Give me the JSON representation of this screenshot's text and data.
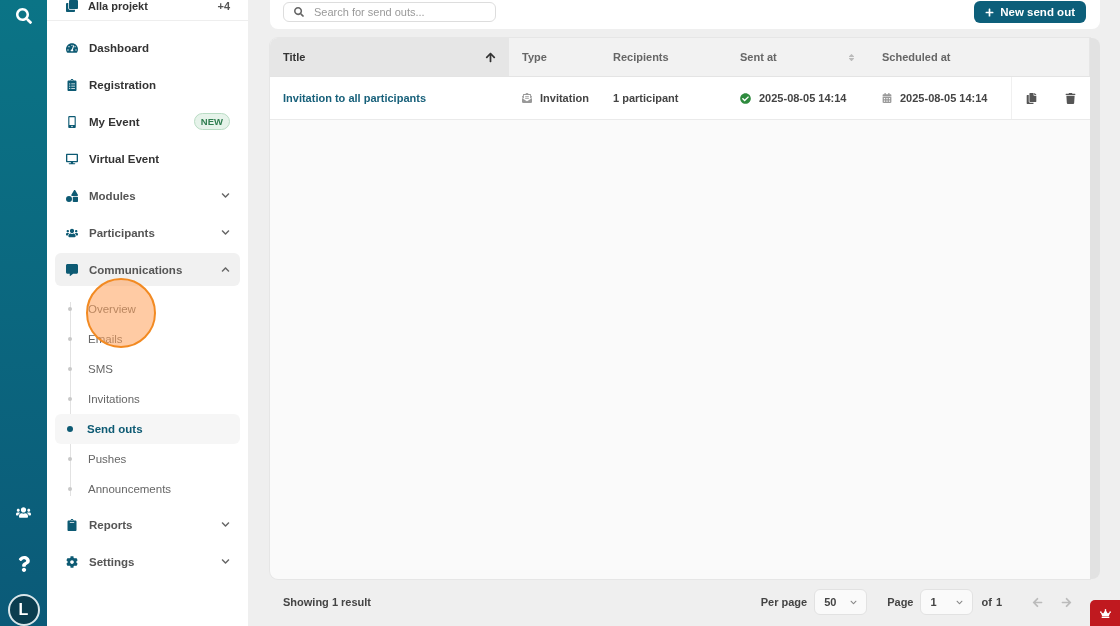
{
  "rail": {
    "avatar_initial": "L"
  },
  "project": {
    "name": "Alla projekt",
    "count": "+4"
  },
  "nav": [
    {
      "kind": "link",
      "label": "Dashboard"
    },
    {
      "kind": "link",
      "label": "Registration"
    },
    {
      "kind": "link",
      "label": "My Event",
      "badge": "NEW"
    },
    {
      "kind": "link",
      "label": "Virtual Event"
    },
    {
      "kind": "group",
      "label": "Modules",
      "expanded": false
    },
    {
      "kind": "group",
      "label": "Participants",
      "expanded": false
    },
    {
      "kind": "group",
      "label": "Communications",
      "expanded": true,
      "children": [
        {
          "label": "Overview",
          "selected": false
        },
        {
          "label": "Emails",
          "selected": false
        },
        {
          "label": "SMS",
          "selected": false
        },
        {
          "label": "Invitations",
          "selected": false
        },
        {
          "label": "Send outs",
          "selected": true
        },
        {
          "label": "Pushes",
          "selected": false
        },
        {
          "label": "Announcements",
          "selected": false
        }
      ]
    },
    {
      "kind": "group",
      "label": "Reports",
      "expanded": false
    },
    {
      "kind": "group",
      "label": "Settings",
      "expanded": false
    }
  ],
  "search": {
    "placeholder": "Search for send outs..."
  },
  "new_button": {
    "label": "New send out"
  },
  "table": {
    "columns": [
      {
        "label": "Title",
        "sortable": true,
        "sorted": true
      },
      {
        "label": "Type"
      },
      {
        "label": "Recipients"
      },
      {
        "label": "Sent at",
        "sortable": true,
        "sorted": false
      },
      {
        "label": "Scheduled at"
      }
    ],
    "rows": [
      {
        "title": "Invitation to all participants",
        "type": "Invitation",
        "recipients": "1 participant",
        "sent": true,
        "sent_at": "2025-08-05 14:14",
        "scheduled_at": "2025-08-05 14:14"
      }
    ]
  },
  "footer": {
    "summary": "Showing 1 result",
    "per_page_label": "Per page",
    "per_page": "50",
    "page_label": "Page",
    "page": "1",
    "of_label": "of",
    "page_count": "1"
  }
}
